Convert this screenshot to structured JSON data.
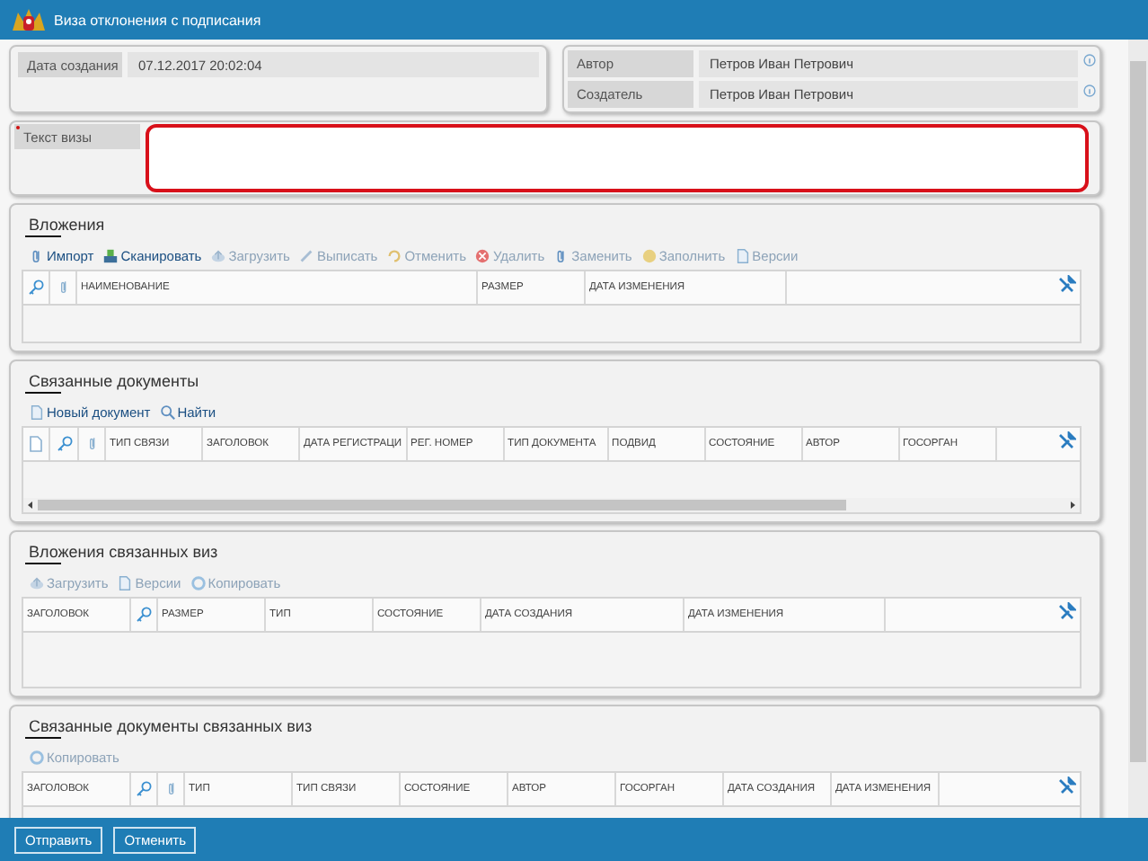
{
  "window": {
    "title": "Виза отклонения с подписания"
  },
  "fields_left": [
    {
      "label": "Дата создания",
      "value": "07.12.2017 20:02:04"
    }
  ],
  "fields_right": [
    {
      "label": "Автор",
      "value": "Петров Иван Петрович"
    },
    {
      "label": "Создатель",
      "value": "Петров Иван Петрович"
    }
  ],
  "visa_text": {
    "label": "Текст визы",
    "required": true
  },
  "sections": [
    {
      "title": "Вложения",
      "scrollbar": false,
      "toolbar": [
        {
          "label": "Импорт",
          "disabled": false
        },
        {
          "label": "Сканировать",
          "disabled": false
        },
        {
          "label": "Загрузить",
          "disabled": true
        },
        {
          "label": "Выписать",
          "disabled": true
        },
        {
          "label": "Отменить",
          "disabled": true
        },
        {
          "label": "Удалить",
          "disabled": true
        },
        {
          "label": "Заменить",
          "disabled": true
        },
        {
          "label": "Заполнить",
          "disabled": true
        },
        {
          "label": "Версии",
          "disabled": true
        }
      ],
      "columns": [
        {
          "kind": "key"
        },
        {
          "kind": "clip"
        },
        {
          "kind": "text",
          "label": "НАИМЕНОВАНИЕ"
        },
        {
          "kind": "text",
          "label": "РАЗМЕР"
        },
        {
          "kind": "text",
          "label": "ДАТА ИЗМЕНЕНИЯ"
        }
      ]
    },
    {
      "title": "Связанные документы",
      "scrollbar": true,
      "toolbar": [
        {
          "label": "Новый документ",
          "disabled": false
        },
        {
          "label": "Найти",
          "disabled": false
        }
      ],
      "columns": [
        {
          "kind": "doc"
        },
        {
          "kind": "key"
        },
        {
          "kind": "clip"
        },
        {
          "kind": "text",
          "label": "ТИП СВЯЗИ"
        },
        {
          "kind": "text",
          "label": "ЗАГОЛОВОК"
        },
        {
          "kind": "text",
          "label": "ДАТА РЕГИСТРАЦИ"
        },
        {
          "kind": "text",
          "label": "РЕГ. НОМЕР"
        },
        {
          "kind": "text",
          "label": "ТИП ДОКУМЕНТА"
        },
        {
          "kind": "text",
          "label": "ПОДВИД"
        },
        {
          "kind": "text",
          "label": "СОСТОЯНИЕ"
        },
        {
          "kind": "text",
          "label": "АВТОР"
        },
        {
          "kind": "text",
          "label": "ГОСОРГАН"
        }
      ]
    },
    {
      "title": "Вложения связанных виз",
      "scrollbar": false,
      "toolbar": [
        {
          "label": "Загрузить",
          "disabled": true
        },
        {
          "label": "Версии",
          "disabled": true
        },
        {
          "label": "Копировать",
          "disabled": true
        }
      ],
      "columns": [
        {
          "kind": "text",
          "label": "ЗАГОЛОВОК"
        },
        {
          "kind": "key"
        },
        {
          "kind": "text",
          "label": "РАЗМЕР"
        },
        {
          "kind": "text",
          "label": "ТИП"
        },
        {
          "kind": "text",
          "label": "СОСТОЯНИЕ"
        },
        {
          "kind": "text",
          "label": "ДАТА СОЗДАНИЯ"
        },
        {
          "kind": "text",
          "label": "ДАТА ИЗМЕНЕНИЯ"
        }
      ]
    },
    {
      "title": "Связанные документы связанных виз",
      "scrollbar": false,
      "toolbar": [
        {
          "label": "Копировать",
          "disabled": true
        }
      ],
      "columns": [
        {
          "kind": "text",
          "label": "ЗАГОЛОВОК"
        },
        {
          "kind": "key"
        },
        {
          "kind": "clip"
        },
        {
          "kind": "text",
          "label": "ТИП"
        },
        {
          "kind": "text",
          "label": "ТИП СВЯЗИ"
        },
        {
          "kind": "text",
          "label": "СОСТОЯНИЕ"
        },
        {
          "kind": "text",
          "label": "АВТОР"
        },
        {
          "kind": "text",
          "label": "ГОСОРГАН"
        },
        {
          "kind": "text",
          "label": "ДАТА СОЗДАНИЯ"
        },
        {
          "kind": "text",
          "label": "ДАТА ИЗМЕНЕНИЯ"
        }
      ]
    }
  ],
  "buttons": [
    "Отправить",
    "Отменить"
  ]
}
